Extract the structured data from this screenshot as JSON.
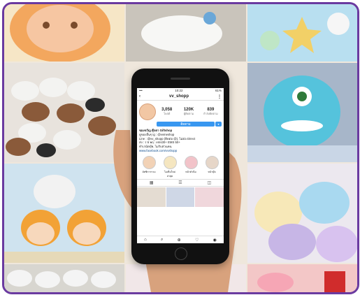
{
  "profile": {
    "username": "vv_shopp",
    "status_time": "10:22",
    "status_battery": "61%",
    "posts": "3,058",
    "posts_label": "โพสต์",
    "followers": "120K",
    "followers_label": "ผู้ติดตาม",
    "following": "839",
    "following_label": "กำลังติดตาม",
    "follow_label": "ติดตาม",
    "bio_name": "ของขวัญ ตุ๊กตา Giftshop",
    "bio_line1": "ดูของอื่นๆ ig : @vvmeshop",
    "bio_line2": "Line : @vv_shopp (ติดต่อ @), ไม่ต่อ Direct",
    "bio_line3": "ส่ง : ร 6 พฤ : ems30+ EMS 50+",
    "bio_line4": "ทำเรนัดบุ๊ค, ไม่รับส่วนคน",
    "bio_link": "www.facebook.com/vvshopp",
    "highlights": [
      "มัทชิการรวม",
      "ไอเท็มใหม่ล่าสุด",
      "หน้าตัวนิ่ม",
      "หน้าบุ๊ค"
    ]
  },
  "icons": [
    "back-icon",
    "more-icon",
    "grid-icon",
    "list-icon",
    "tagged-icon",
    "home-icon",
    "search-icon",
    "add-icon",
    "heart-icon",
    "profile-icon"
  ]
}
